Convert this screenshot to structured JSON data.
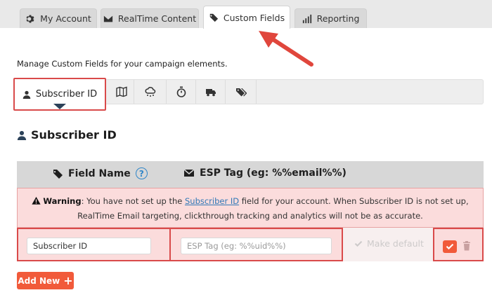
{
  "top_tabs": [
    {
      "label": "My Account",
      "icon": "gear-icon"
    },
    {
      "label": "RealTime Content",
      "icon": "envelope-icon"
    },
    {
      "label": "Custom Fields",
      "icon": "tag-icon",
      "active": true
    },
    {
      "label": "Reporting",
      "icon": "bar-chart-icon"
    }
  ],
  "intro_text": "Manage Custom Fields for your campaign elements.",
  "sub_tabs": [
    {
      "label": "Subscriber ID",
      "icon": "user-icon",
      "active": true
    },
    {
      "icon": "map-icon"
    },
    {
      "icon": "weather-icon"
    },
    {
      "icon": "stopwatch-icon"
    },
    {
      "icon": "truck-icon"
    },
    {
      "icon": "tags-icon"
    }
  ],
  "section_title": "Subscriber ID",
  "table": {
    "col_field_name": "Field Name",
    "col_esp_tag": "ESP Tag (eg: %%email%%)",
    "help_glyph": "?"
  },
  "warning": {
    "label": "Warning",
    "text_before": ": You have not set up the ",
    "link": "Subscriber ID",
    "text_after": " field for your account. When Subscriber ID is not set up, RealTime Email targeting, clickthrough tracking and analytics will not be as accurate."
  },
  "row": {
    "field_value": "Subscriber ID",
    "esp_placeholder": "ESP Tag (eg: %%uid%%)",
    "make_default": "Make default"
  },
  "add_new_label": "Add New",
  "colors": {
    "accent": "#f15a3a",
    "highlight_border": "#d94a4a",
    "warning_bg": "#fbdcdc",
    "link": "#2f78b7"
  }
}
